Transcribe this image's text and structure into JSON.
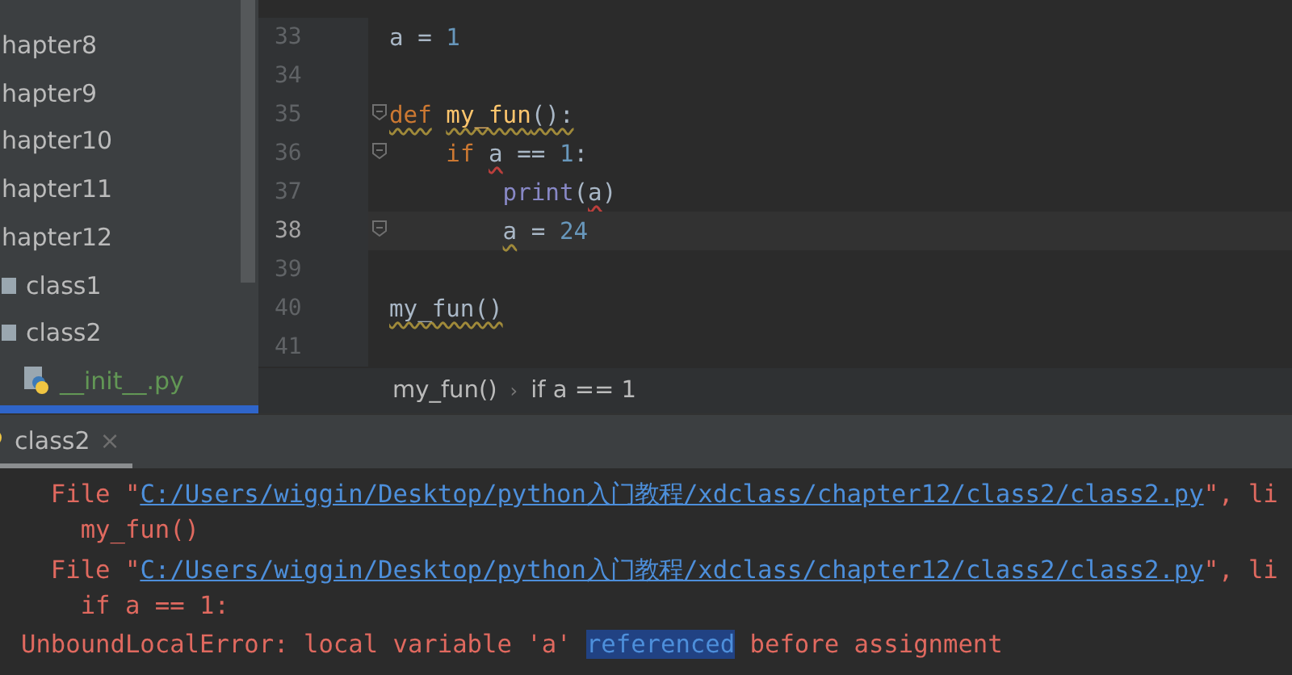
{
  "sidebar": {
    "items": [
      {
        "label": "hapter8",
        "kind": "plain"
      },
      {
        "label": "hapter9",
        "kind": "plain"
      },
      {
        "label": "hapter10",
        "kind": "plain"
      },
      {
        "label": "hapter11",
        "kind": "plain"
      },
      {
        "label": "hapter12",
        "kind": "plain"
      },
      {
        "label": "class1",
        "kind": "folder"
      },
      {
        "label": "class2",
        "kind": "folder"
      },
      {
        "label": "__init__.py",
        "kind": "pyfile"
      }
    ]
  },
  "editor": {
    "lines": [
      {
        "number": "33",
        "current": false,
        "fold": false,
        "tokens": [
          {
            "text": "a = ",
            "kind": "plain"
          },
          {
            "text": "1",
            "kind": "number"
          }
        ]
      },
      {
        "number": "34",
        "current": false,
        "fold": false
      },
      {
        "number": "35",
        "current": false,
        "fold": true,
        "tokens": [
          {
            "text": "def",
            "kind": "keyword",
            "warning": true
          },
          {
            "text": " my_fun",
            "kind": "func",
            "warning": true
          },
          {
            "text": "():",
            "kind": "plain",
            "warning": true
          }
        ]
      },
      {
        "number": "36",
        "current": false,
        "fold": true,
        "tokens": [
          {
            "text": "    if",
            "kind": "keyword"
          },
          {
            "text": " a",
            "kind": "plain",
            "error": true
          },
          {
            "text": " == ",
            "kind": "plain"
          },
          {
            "text": "1",
            "kind": "number"
          },
          {
            "text": ":",
            "kind": "plain"
          }
        ]
      },
      {
        "number": "37",
        "current": false,
        "fold": false,
        "tokens": [
          {
            "text": "        print",
            "kind": "builtin"
          },
          {
            "text": "(",
            "kind": "plain"
          },
          {
            "text": "a",
            "kind": "plain",
            "error": true
          },
          {
            "text": ")",
            "kind": "plain"
          }
        ]
      },
      {
        "number": "38",
        "current": true,
        "fold": true,
        "tokens": [
          {
            "text": "        a",
            "kind": "plain",
            "warning": true
          },
          {
            "text": " = ",
            "kind": "plain"
          },
          {
            "text": "24",
            "kind": "number"
          }
        ]
      },
      {
        "number": "39",
        "current": false,
        "fold": false
      },
      {
        "number": "40",
        "current": false,
        "fold": false,
        "tokens": [
          {
            "text": "my_fun()",
            "kind": "plain",
            "warning": true
          }
        ]
      },
      {
        "number": "41",
        "current": false,
        "fold": false
      }
    ]
  },
  "breadcrumb": {
    "items": [
      "my_fun()",
      "if a == 1"
    ],
    "separator": "›"
  },
  "run_panel": {
    "tab": {
      "label": "class2",
      "close": "×"
    },
    "lines": [
      {
        "segments": [
          {
            "text": "  File \"",
            "kind": "text"
          },
          {
            "text": "C:/Users/wiggin/Desktop/python入门教程/xdclass/chapter12/class2/class2.py",
            "kind": "link"
          },
          {
            "text": "\", li",
            "kind": "text"
          }
        ]
      },
      {
        "segments": [
          {
            "text": "    my_fun()",
            "kind": "text"
          }
        ]
      },
      {
        "segments": [
          {
            "text": "  File \"",
            "kind": "text"
          },
          {
            "text": "C:/Users/wiggin/Desktop/python入门教程/xdclass/chapter12/class2/class2.py",
            "kind": "link"
          },
          {
            "text": "\", li",
            "kind": "text"
          }
        ]
      },
      {
        "segments": [
          {
            "text": "    if a == 1:",
            "kind": "text"
          }
        ]
      },
      {
        "segments": [
          {
            "text": "UnboundLocalError: local variable 'a' ",
            "kind": "text"
          },
          {
            "text": "referenced",
            "kind": "highlight"
          },
          {
            "text": " before assignment",
            "kind": "text"
          }
        ]
      }
    ]
  }
}
